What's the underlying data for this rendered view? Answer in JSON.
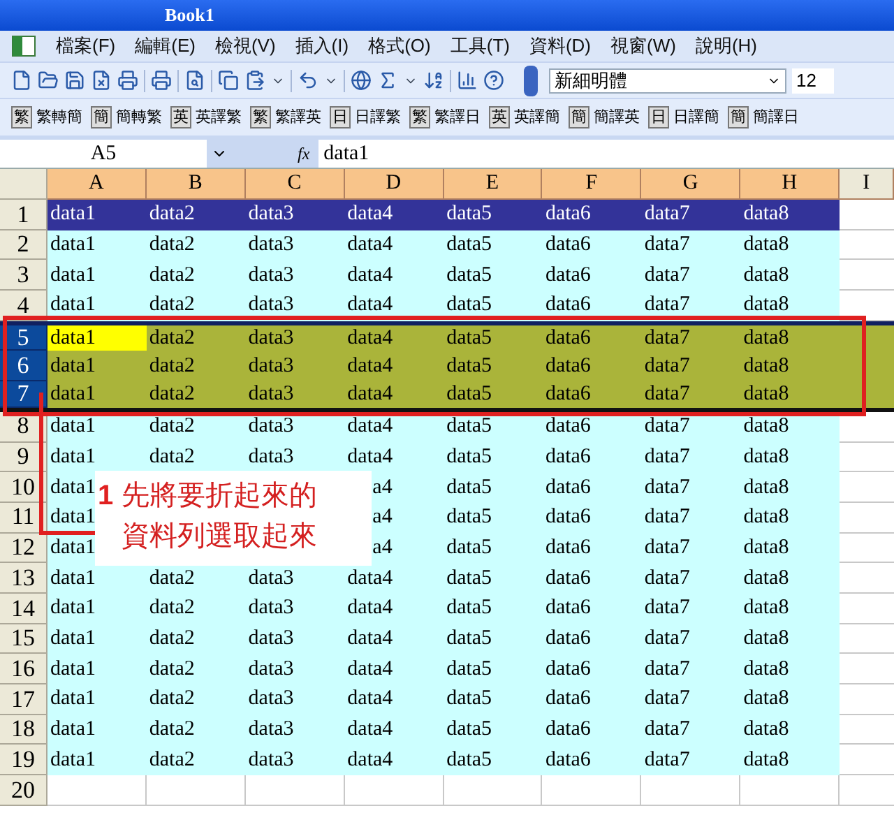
{
  "window": {
    "title": "Book1"
  },
  "menu": [
    "檔案(F)",
    "編輯(E)",
    "檢視(V)",
    "插入(I)",
    "格式(O)",
    "工具(T)",
    "資料(D)",
    "視窗(W)",
    "說明(H)"
  ],
  "format_toolbar": {
    "font": "新細明體",
    "size": "12"
  },
  "translate_toolbar": [
    {
      "glyph": "繁",
      "label": "繁轉簡"
    },
    {
      "glyph": "簡",
      "label": "簡轉繁"
    },
    {
      "glyph": "英",
      "label": "英譯繁"
    },
    {
      "glyph": "繁",
      "label": "繁譯英"
    },
    {
      "glyph": "日",
      "label": "日譯繁"
    },
    {
      "glyph": "繁",
      "label": "繁譯日"
    },
    {
      "glyph": "英",
      "label": "英譯簡"
    },
    {
      "glyph": "簡",
      "label": "簡譯英"
    },
    {
      "glyph": "日",
      "label": "日譯簡"
    },
    {
      "glyph": "簡",
      "label": "簡譯日"
    }
  ],
  "formula_bar": {
    "name_box": "A5",
    "function_label": "fx",
    "formula": "data1"
  },
  "columns": [
    "A",
    "B",
    "C",
    "D",
    "E",
    "F",
    "G",
    "H",
    "I"
  ],
  "rows": [
    {
      "header": "1",
      "kind": "heading",
      "selected": false,
      "cursor": false,
      "cells": [
        "data1",
        "data2",
        "data3",
        "data4",
        "data5",
        "data6",
        "data7",
        "data8"
      ]
    },
    {
      "header": "2",
      "kind": "data",
      "selected": false,
      "cursor": false,
      "cells": [
        "data1",
        "data2",
        "data3",
        "data4",
        "data5",
        "data6",
        "data7",
        "data8"
      ]
    },
    {
      "header": "3",
      "kind": "data",
      "selected": false,
      "cursor": false,
      "cells": [
        "data1",
        "data2",
        "data3",
        "data4",
        "data5",
        "data6",
        "data7",
        "data8"
      ]
    },
    {
      "header": "4",
      "kind": "data",
      "selected": false,
      "cursor": false,
      "cells": [
        "data1",
        "data2",
        "data3",
        "data4",
        "data5",
        "data6",
        "data7",
        "data8"
      ]
    },
    {
      "header": "5",
      "kind": "data",
      "selected": true,
      "cursor": true,
      "cells": [
        "data1",
        "data2",
        "data3",
        "data4",
        "data5",
        "data6",
        "data7",
        "data8"
      ]
    },
    {
      "header": "6",
      "kind": "data",
      "selected": true,
      "cursor": false,
      "cells": [
        "data1",
        "data2",
        "data3",
        "data4",
        "data5",
        "data6",
        "data7",
        "data8"
      ]
    },
    {
      "header": "7",
      "kind": "data",
      "selected": true,
      "cursor": false,
      "cells": [
        "data1",
        "data2",
        "data3",
        "data4",
        "data5",
        "data6",
        "data7",
        "data8"
      ]
    },
    {
      "header": "8",
      "kind": "data",
      "selected": false,
      "cursor": false,
      "cells": [
        "data1",
        "data2",
        "data3",
        "data4",
        "data5",
        "data6",
        "data7",
        "data8"
      ]
    },
    {
      "header": "9",
      "kind": "data",
      "selected": false,
      "cursor": false,
      "cells": [
        "data1",
        "data2",
        "data3",
        "data4",
        "data5",
        "data6",
        "data7",
        "data8"
      ]
    },
    {
      "header": "10",
      "kind": "data",
      "selected": false,
      "cursor": false,
      "behind_callout": true,
      "cells": [
        "data1",
        "",
        "",
        "a4",
        "data5",
        "data6",
        "data7",
        "data8"
      ]
    },
    {
      "header": "11",
      "kind": "data",
      "selected": false,
      "cursor": false,
      "behind_callout": true,
      "cells": [
        "data1",
        "",
        "",
        "a4",
        "data5",
        "data6",
        "data7",
        "data8"
      ]
    },
    {
      "header": "12",
      "kind": "data",
      "selected": false,
      "cursor": false,
      "behind_callout": true,
      "cells": [
        "data1",
        "",
        "",
        "a4",
        "data5",
        "data6",
        "data7",
        "data8"
      ]
    },
    {
      "header": "13",
      "kind": "data",
      "selected": false,
      "cursor": false,
      "cells": [
        "data1",
        "data2",
        "data3",
        "data4",
        "data5",
        "data6",
        "data7",
        "data8"
      ]
    },
    {
      "header": "14",
      "kind": "data",
      "selected": false,
      "cursor": false,
      "cells": [
        "data1",
        "data2",
        "data3",
        "data4",
        "data5",
        "data6",
        "data7",
        "data8"
      ]
    },
    {
      "header": "15",
      "kind": "data",
      "selected": false,
      "cursor": false,
      "cells": [
        "data1",
        "data2",
        "data3",
        "data4",
        "data5",
        "data6",
        "data7",
        "data8"
      ]
    },
    {
      "header": "16",
      "kind": "data",
      "selected": false,
      "cursor": false,
      "cells": [
        "data1",
        "data2",
        "data3",
        "data4",
        "data5",
        "data6",
        "data7",
        "data8"
      ]
    },
    {
      "header": "17",
      "kind": "data",
      "selected": false,
      "cursor": false,
      "cells": [
        "data1",
        "data2",
        "data3",
        "data4",
        "data5",
        "data6",
        "data7",
        "data8"
      ]
    },
    {
      "header": "18",
      "kind": "data",
      "selected": false,
      "cursor": false,
      "cells": [
        "data1",
        "data2",
        "data3",
        "data4",
        "data5",
        "data6",
        "data7",
        "data8"
      ]
    },
    {
      "header": "19",
      "kind": "data",
      "selected": false,
      "cursor": false,
      "cells": [
        "data1",
        "data2",
        "data3",
        "data4",
        "data5",
        "data6",
        "data7",
        "data8"
      ]
    },
    {
      "header": "20",
      "kind": "blank",
      "selected": false,
      "cursor": false
    }
  ],
  "annotation": {
    "number": "1",
    "lines": [
      "先將要折起來的",
      "資料列選取起來"
    ]
  }
}
